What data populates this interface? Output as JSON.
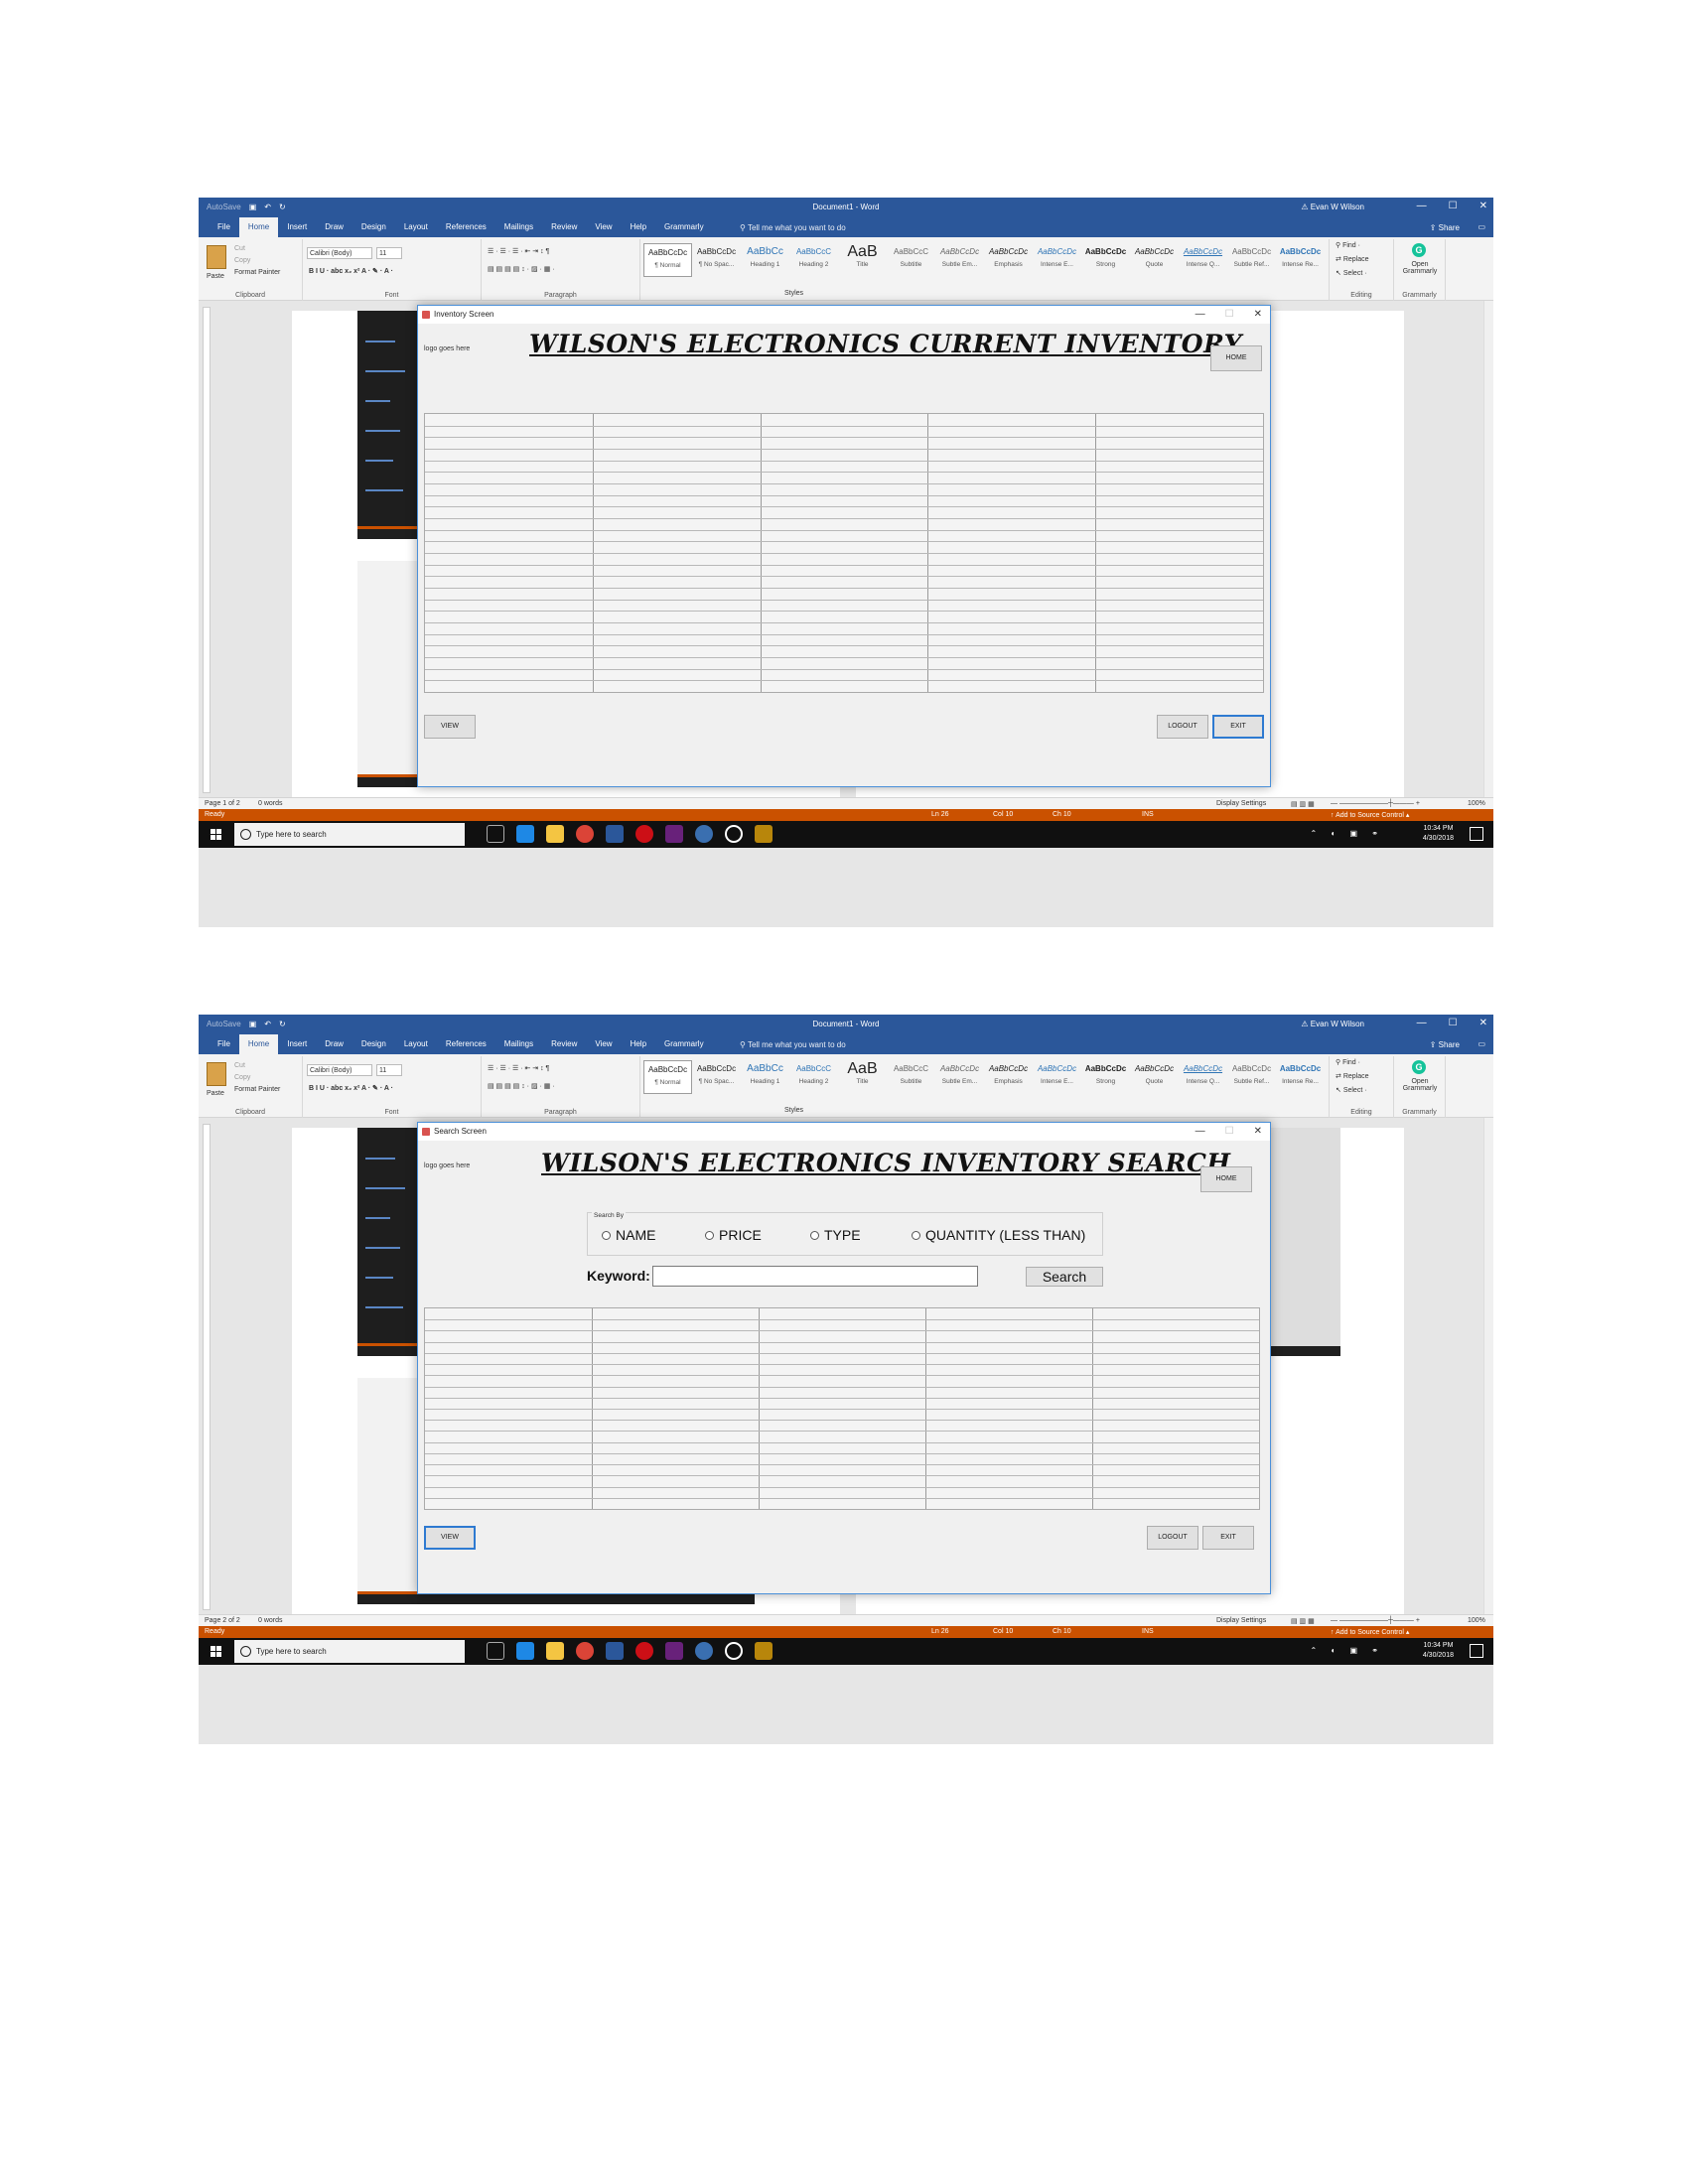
{
  "word": {
    "title": "Document1  -  Word",
    "autosave": "AutoSave",
    "user": "Evan W Wilson",
    "tabs": [
      "File",
      "Home",
      "Insert",
      "Draw",
      "Design",
      "Layout",
      "References",
      "Mailings",
      "Review",
      "View",
      "Help",
      "Grammarly"
    ],
    "tell_me": "Tell me what you want to do",
    "share": "Share",
    "clipboard": {
      "paste": "Paste",
      "cut": "Cut",
      "copy": "Copy",
      "format_painter": "Format Painter",
      "label": "Clipboard"
    },
    "font": {
      "name": "Calibri (Body)",
      "size": "11",
      "label": "Font"
    },
    "paragraph_label": "Paragraph",
    "styles_label": "Styles",
    "styles": [
      {
        "preview": "AaBbCcDc",
        "name": "¶ Normal"
      },
      {
        "preview": "AaBbCcDc",
        "name": "¶ No Spac..."
      },
      {
        "preview": "AaBbCc",
        "name": "Heading 1"
      },
      {
        "preview": "AaBbCcC",
        "name": "Heading 2"
      },
      {
        "preview": "AaB",
        "name": "Title"
      },
      {
        "preview": "AaBbCcC",
        "name": "Subtitle"
      },
      {
        "preview": "AaBbCcDc",
        "name": "Subtle Em..."
      },
      {
        "preview": "AaBbCcDc",
        "name": "Emphasis"
      },
      {
        "preview": "AaBbCcDc",
        "name": "Intense E..."
      },
      {
        "preview": "AaBbCcDc",
        "name": "Strong"
      },
      {
        "preview": "AaBbCcDc",
        "name": "Quote"
      },
      {
        "preview": "AaBbCcDc",
        "name": "Intense Q..."
      },
      {
        "preview": "AaBbCcDc",
        "name": "Subtle Ref..."
      },
      {
        "preview": "AaBbCcDc",
        "name": "Intense Re..."
      }
    ],
    "editing": {
      "find": "Find",
      "replace": "Replace",
      "select": "Select",
      "label": "Editing"
    },
    "grammarly": {
      "open": "Open Grammarly",
      "label": "Grammarly"
    },
    "status": {
      "page1": "Page 1 of 2",
      "page2": "Page 2 of 2",
      "words": "0 words",
      "display": "Display Settings",
      "zoom": "100%"
    },
    "vs_status": {
      "ready": "Ready",
      "ln": "Ln 26",
      "col": "Col 10",
      "ch": "Ch 10",
      "ins": "INS",
      "source_control": "Add to Source Control"
    }
  },
  "taskbar": {
    "search_placeholder": "Type here to search",
    "time": "10:34 PM",
    "date": "4/30/2018"
  },
  "inventory": {
    "window_title": "Inventory Screen",
    "logo": "logo goes here",
    "heading": "WILSON'S ELECTRONICS CURRENT INVENTORY",
    "home": "HOME",
    "view": "VIEW",
    "logout": "LOGOUT",
    "exit": "EXIT"
  },
  "search": {
    "window_title": "Search Screen",
    "logo": "logo goes here",
    "heading": "WILSON'S ELECTRONICS INVENTORY SEARCH",
    "home": "HOME",
    "search_by": "Search By",
    "options": [
      "NAME",
      "PRICE",
      "TYPE",
      "QUANTITY (LESS THAN)"
    ],
    "keyword_label": "Keyword:",
    "keyword_value": "",
    "search_button": "Search",
    "view": "VIEW",
    "logout": "LOGOUT",
    "exit": "EXIT"
  },
  "colors": {
    "word_blue": "#2b579a",
    "vs_orange": "#ca5100",
    "focus_blue": "#2e7ad1"
  }
}
